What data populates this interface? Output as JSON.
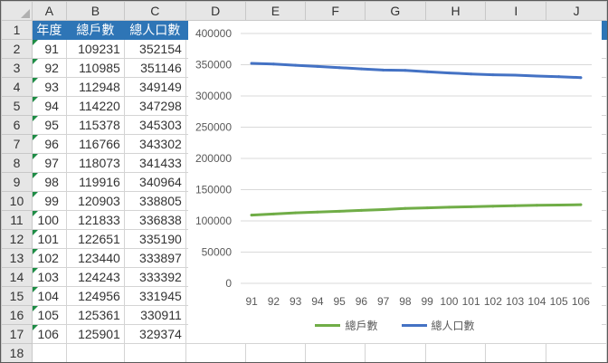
{
  "columns": [
    "A",
    "B",
    "C",
    "D",
    "E",
    "F",
    "G",
    "H",
    "I",
    "J"
  ],
  "row_numbers": [
    1,
    2,
    3,
    4,
    5,
    6,
    7,
    8,
    9,
    10,
    11,
    12,
    13,
    14,
    15,
    16,
    17,
    18
  ],
  "table": {
    "headers": [
      "年度",
      "總戶數",
      "總人口數"
    ],
    "rows": [
      [
        "91",
        "109231",
        "352154"
      ],
      [
        "92",
        "110985",
        "351146"
      ],
      [
        "93",
        "112948",
        "349149"
      ],
      [
        "94",
        "114220",
        "347298"
      ],
      [
        "95",
        "115378",
        "345303"
      ],
      [
        "96",
        "116766",
        "343302"
      ],
      [
        "97",
        "118073",
        "341433"
      ],
      [
        "98",
        "119916",
        "340964"
      ],
      [
        "99",
        "120903",
        "338805"
      ],
      [
        "100",
        "121833",
        "336838"
      ],
      [
        "101",
        "122651",
        "335190"
      ],
      [
        "102",
        "123440",
        "333897"
      ],
      [
        "103",
        "124243",
        "333392"
      ],
      [
        "104",
        "124956",
        "331945"
      ],
      [
        "105",
        "125361",
        "330911"
      ],
      [
        "106",
        "125901",
        "329374"
      ]
    ]
  },
  "colors": {
    "header_fill": "#2e75b6",
    "error_marker": "#1e8c45",
    "series_households": "#70ad47",
    "series_population": "#4472c4"
  },
  "chart_data": {
    "type": "line",
    "categories": [
      "91",
      "92",
      "93",
      "94",
      "95",
      "96",
      "97",
      "98",
      "99",
      "100",
      "101",
      "102",
      "103",
      "104",
      "105",
      "106"
    ],
    "series": [
      {
        "name": "總戶數",
        "color": "#70ad47",
        "values": [
          109231,
          110985,
          112948,
          114220,
          115378,
          116766,
          118073,
          119916,
          120903,
          121833,
          122651,
          123440,
          124243,
          124956,
          125361,
          125901
        ]
      },
      {
        "name": "總人口數",
        "color": "#4472c4",
        "values": [
          352154,
          351146,
          349149,
          347298,
          345303,
          343302,
          341433,
          340964,
          338805,
          336838,
          335190,
          333897,
          333392,
          331945,
          330911,
          329374
        ]
      }
    ],
    "y_ticks": [
      "0",
      "50000",
      "100000",
      "150000",
      "200000",
      "250000",
      "300000",
      "350000",
      "400000"
    ],
    "ylim": [
      0,
      400000
    ],
    "grid": true,
    "legend_position": "bottom"
  }
}
